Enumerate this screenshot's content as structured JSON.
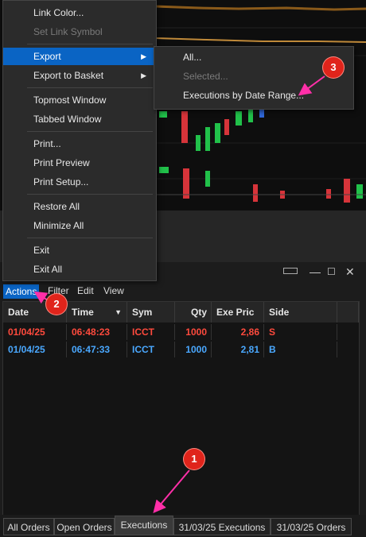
{
  "context_menu": {
    "items": [
      {
        "label": "Link Color...",
        "disabled": false
      },
      {
        "label": "Set Link Symbol",
        "disabled": true
      },
      {
        "label": "Export",
        "disabled": false,
        "submenu": true,
        "selected": true
      },
      {
        "label": "Export to Basket",
        "disabled": false,
        "submenu": true
      },
      {
        "label": "Topmost Window",
        "disabled": false
      },
      {
        "label": "Tabbed Window",
        "disabled": false
      },
      {
        "label": "Print...",
        "disabled": false
      },
      {
        "label": "Print Preview",
        "disabled": false
      },
      {
        "label": "Print Setup...",
        "disabled": false
      },
      {
        "label": "Restore All",
        "disabled": false
      },
      {
        "label": "Minimize All",
        "disabled": false
      },
      {
        "label": "Exit",
        "disabled": false
      },
      {
        "label": "Exit All",
        "disabled": false
      }
    ]
  },
  "export_submenu": {
    "items": [
      {
        "label": "All...",
        "disabled": false
      },
      {
        "label": "Selected...",
        "disabled": true
      },
      {
        "label": "Executions by Date Range...",
        "disabled": false
      }
    ]
  },
  "window": {
    "menubar": [
      "Actions",
      "Filter",
      "Edit",
      "View"
    ],
    "columns": [
      "Date",
      "Time",
      "Sym",
      "Qty",
      "Exe Pric",
      "Side"
    ],
    "rows": [
      {
        "date": "01/04/25",
        "time": "06:48:23",
        "sym": "ICCT",
        "qty": "1000",
        "price": "2,86",
        "side": "S",
        "color": "#ff4a3d"
      },
      {
        "date": "01/04/25",
        "time": "06:47:33",
        "sym": "ICCT",
        "qty": "1000",
        "price": "2,81",
        "side": "B",
        "color": "#4aa8ff"
      }
    ],
    "tabs": [
      "All Orders",
      "Open Orders",
      "Executions",
      "31/03/25 Executions",
      "31/03/25 Orders"
    ],
    "active_tab": "Executions"
  },
  "annotations": [
    "1",
    "2",
    "3"
  ],
  "colors": {
    "sell": "#ff4a3d",
    "buy": "#4aa8ff",
    "highlight": "#0a64c4",
    "annotation": "#e0241b",
    "arrow": "#ff2fa8"
  }
}
